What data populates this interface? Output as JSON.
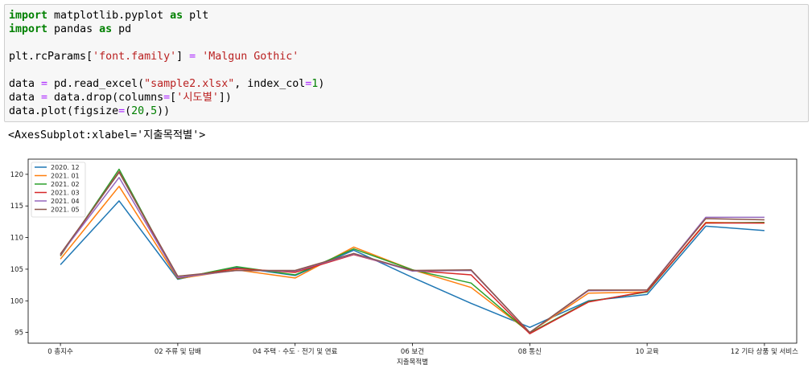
{
  "code_cell": {
    "lines": [
      [
        {
          "t": "import",
          "c": "kw"
        },
        {
          "t": " matplotlib.pyplot "
        },
        {
          "t": "as",
          "c": "kw"
        },
        {
          "t": " plt"
        }
      ],
      [
        {
          "t": "import",
          "c": "kw"
        },
        {
          "t": " pandas "
        },
        {
          "t": "as",
          "c": "kw"
        },
        {
          "t": " pd"
        }
      ],
      [],
      [
        {
          "t": "plt.rcParams["
        },
        {
          "t": "'font.family'",
          "c": "str"
        },
        {
          "t": "] "
        },
        {
          "t": "=",
          "c": "op"
        },
        {
          "t": " "
        },
        {
          "t": "'Malgun Gothic'",
          "c": "str"
        }
      ],
      [],
      [
        {
          "t": "data "
        },
        {
          "t": "=",
          "c": "op"
        },
        {
          "t": " pd.read_excel("
        },
        {
          "t": "\"sample2.xlsx\"",
          "c": "str"
        },
        {
          "t": ", index_col"
        },
        {
          "t": "=",
          "c": "op"
        },
        {
          "t": "1",
          "c": "num"
        },
        {
          "t": ")"
        }
      ],
      [
        {
          "t": "data "
        },
        {
          "t": "=",
          "c": "op"
        },
        {
          "t": " data.drop(columns"
        },
        {
          "t": "=",
          "c": "op"
        },
        {
          "t": "["
        },
        {
          "t": "'시도별'",
          "c": "str"
        },
        {
          "t": "])"
        }
      ],
      [
        {
          "t": "data.plot(figsize"
        },
        {
          "t": "=",
          "c": "op"
        },
        {
          "t": "("
        },
        {
          "t": "20",
          "c": "num"
        },
        {
          "t": ","
        },
        {
          "t": "5",
          "c": "num"
        },
        {
          "t": "))"
        }
      ]
    ]
  },
  "output": {
    "text": "<AxesSubplot:xlabel='지출목적별'>"
  },
  "chart_data": {
    "type": "line",
    "xlabel": "지출목적별",
    "ylabel": "",
    "ylim": [
      93.3,
      122.4
    ],
    "yticks": [
      95,
      100,
      105,
      110,
      115,
      120
    ],
    "x": [
      0,
      1,
      2,
      3,
      4,
      5,
      6,
      7,
      8,
      9,
      10,
      11,
      12
    ],
    "xlim": [
      -0.55,
      12.55
    ],
    "xticks": [
      {
        "x": 0,
        "label": "0 총지수"
      },
      {
        "x": 2,
        "label": "02 주류 및 담배"
      },
      {
        "x": 4,
        "label": "04 주택 · 수도 · 전기 및 연료"
      },
      {
        "x": 6,
        "label": "06 보건"
      },
      {
        "x": 8,
        "label": "08 통신"
      },
      {
        "x": 10,
        "label": "10 교육"
      },
      {
        "x": 12,
        "label": "12 기타 상품 및 서비스"
      }
    ],
    "legend_position": "upper-left",
    "grid": false,
    "series": [
      {
        "name": "2020. 12",
        "color": "#1f77b4",
        "values": [
          105.7,
          115.8,
          103.4,
          105.3,
          104.0,
          108.0,
          103.7,
          99.6,
          95.8,
          100.0,
          101.0,
          111.8,
          111.1
        ]
      },
      {
        "name": "2021. 01",
        "color": "#ff7f0e",
        "values": [
          106.6,
          118.1,
          103.5,
          104.9,
          103.6,
          108.5,
          104.9,
          102.1,
          95.0,
          101.2,
          101.4,
          112.4,
          112.3
        ]
      },
      {
        "name": "2021. 02",
        "color": "#2ca02c",
        "values": [
          107.1,
          120.8,
          103.5,
          105.4,
          104.1,
          108.2,
          104.9,
          102.8,
          94.9,
          99.9,
          101.4,
          112.3,
          112.4
        ]
      },
      {
        "name": "2021. 03",
        "color": "#d62728",
        "values": [
          107.2,
          120.4,
          103.6,
          105.1,
          104.5,
          107.3,
          104.8,
          104.1,
          94.8,
          99.8,
          101.5,
          112.3,
          112.3
        ]
      },
      {
        "name": "2021. 04",
        "color": "#9467bd",
        "values": [
          107.3,
          119.5,
          103.7,
          104.8,
          104.7,
          107.4,
          104.7,
          104.8,
          95.0,
          101.6,
          101.7,
          113.2,
          113.2
        ]
      },
      {
        "name": "2021. 05",
        "color": "#8c564b",
        "values": [
          107.4,
          120.3,
          103.9,
          104.8,
          104.8,
          107.5,
          104.8,
          104.9,
          95.0,
          101.7,
          101.7,
          113.0,
          112.8
        ]
      }
    ]
  }
}
